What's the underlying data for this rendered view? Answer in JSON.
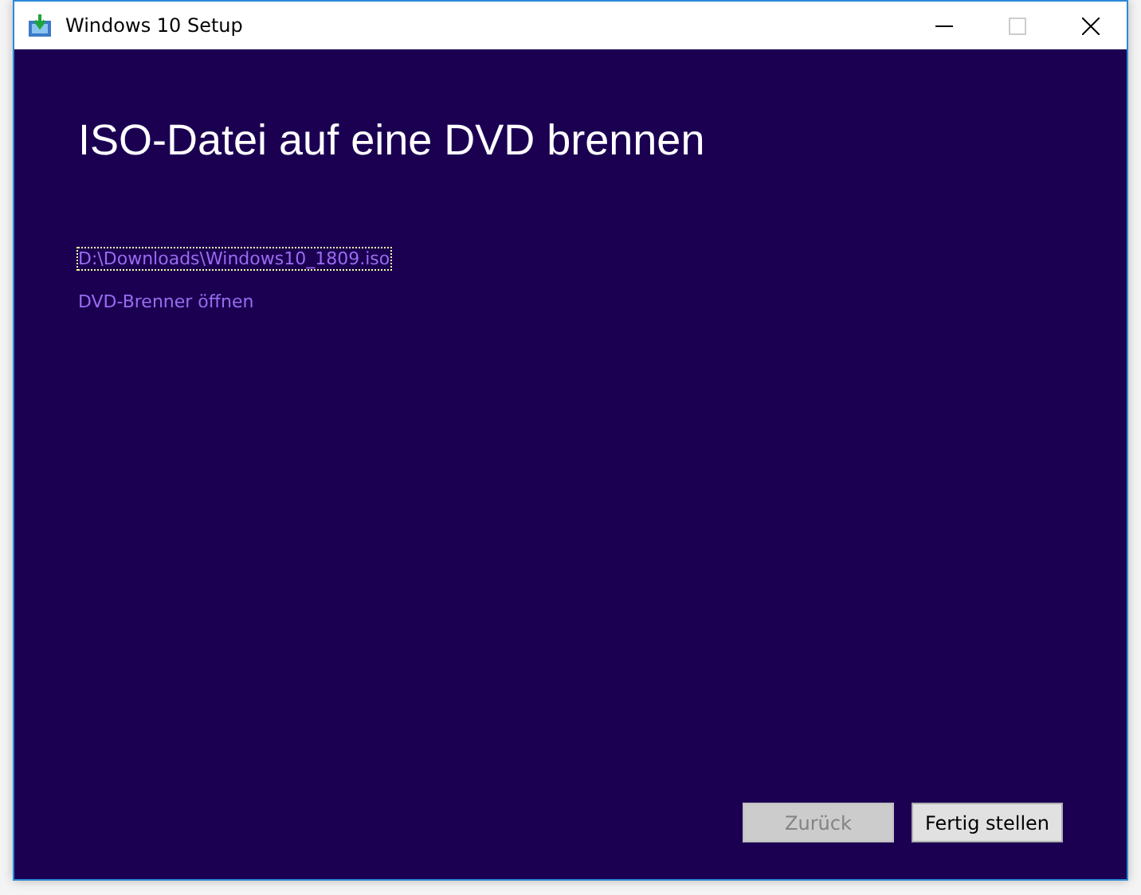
{
  "window": {
    "title": "Windows 10 Setup"
  },
  "heading": "ISO-Datei auf eine DVD brennen",
  "links": [
    {
      "label": "D:\\Downloads\\Windows10_1809.iso",
      "focused": true
    },
    {
      "label": "DVD-Brenner öffnen",
      "focused": false
    }
  ],
  "buttons": [
    {
      "label": "Zurück",
      "disabled": true
    },
    {
      "label": "Fertig stellen",
      "disabled": false
    }
  ]
}
